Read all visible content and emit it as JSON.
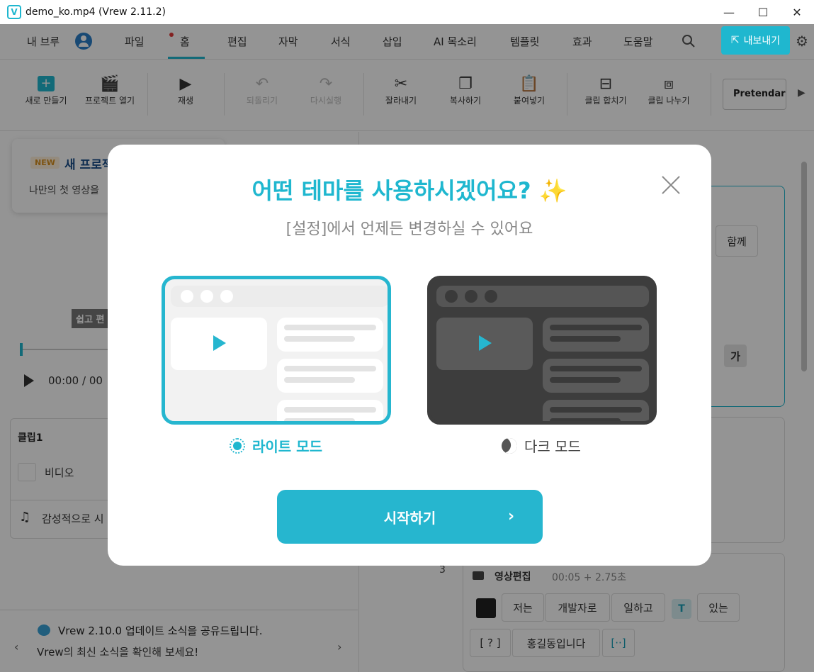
{
  "window": {
    "title": "demo_ko.mp4 (Vrew 2.11.2)",
    "logo": "V",
    "controls": {
      "minimize": "—",
      "maximize": "☐",
      "close": "✕"
    }
  },
  "menu": {
    "user": "내 브루",
    "items": [
      "파일",
      "홈",
      "편집",
      "자막",
      "서식",
      "삽입",
      "AI 목소리",
      "템플릿",
      "효과",
      "도움말"
    ],
    "export": "내보내기"
  },
  "toolbar": {
    "new": "새로 만들기",
    "open": "프로젝트 열기",
    "play": "재생",
    "undo": "되돌리기",
    "redo": "다시실행",
    "cut": "잘라내기",
    "copy": "복사하기",
    "paste": "붙여넣기",
    "merge": "클립 합치기",
    "split": "클립 나누기",
    "font": "Pretendard"
  },
  "left": {
    "tip_badge": "NEW",
    "tip_title": "새 프로젝",
    "tip_desc": "나만의 첫 영상을",
    "video_caption": "쉽고 편",
    "time": "00:00  / 00",
    "clip_title": "클립1",
    "clip_video": "비디오",
    "clip_music": "감성적으로 시",
    "news_title": "Vrew 2.10.0 업데이트 소식을 공유드립니다.",
    "news_sub": "Vrew의 최신 소식을 확인해 보세요!"
  },
  "right": {
    "chip_together": "함께",
    "chip_ga": "가",
    "row_num": "3",
    "seg_title": "영상편집",
    "seg_time": "00:05 + 2.75초",
    "words_row1": [
      "저는",
      "개발자로",
      "일하고",
      "있는"
    ],
    "words_row2": [
      "[ ? ]",
      "홍길동입니다",
      "[··]"
    ],
    "t_icon": "T"
  },
  "modal": {
    "title": "어떤 테마를 사용하시겠어요?",
    "sparkle": "✨",
    "subtitle": "[설정]에서 언제든 변경하실 수 있어요",
    "light_label": "라이트 모드",
    "dark_label": "다크 모드",
    "start": "시작하기",
    "start_arrow": "›"
  },
  "colors": {
    "accent": "#1fb7cf",
    "dark_preview": "#3d3d3d"
  }
}
